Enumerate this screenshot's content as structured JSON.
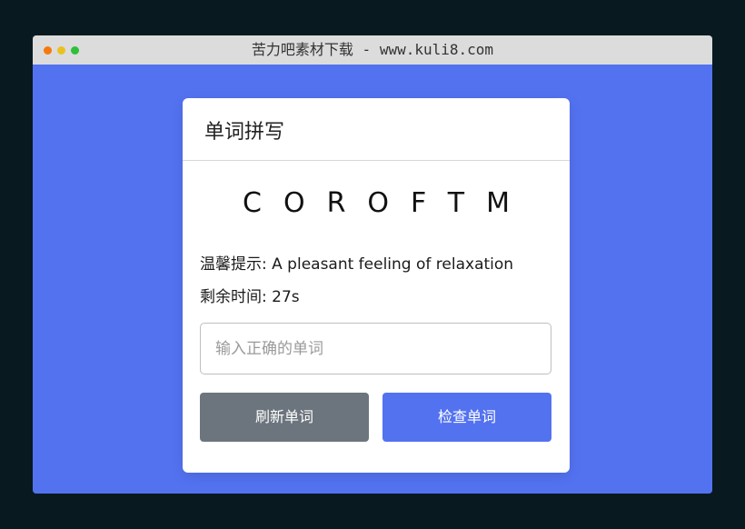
{
  "window": {
    "title": "苦力吧素材下载 - www.kuli8.com"
  },
  "card": {
    "title": "单词拼写",
    "scrambled_word": "COROFTM",
    "hint_label": "温馨提示:",
    "hint_text": "A pleasant feeling of relaxation",
    "time_label": "剩余时间:",
    "time_value": "27s",
    "input_placeholder": "输入正确的单词",
    "refresh_button": "刷新单词",
    "check_button": "检查单词"
  },
  "colors": {
    "background": "#081a1f",
    "accent": "#5372f0",
    "refresh_button": "#6c757d",
    "titlebar": "#dcdcdc"
  }
}
